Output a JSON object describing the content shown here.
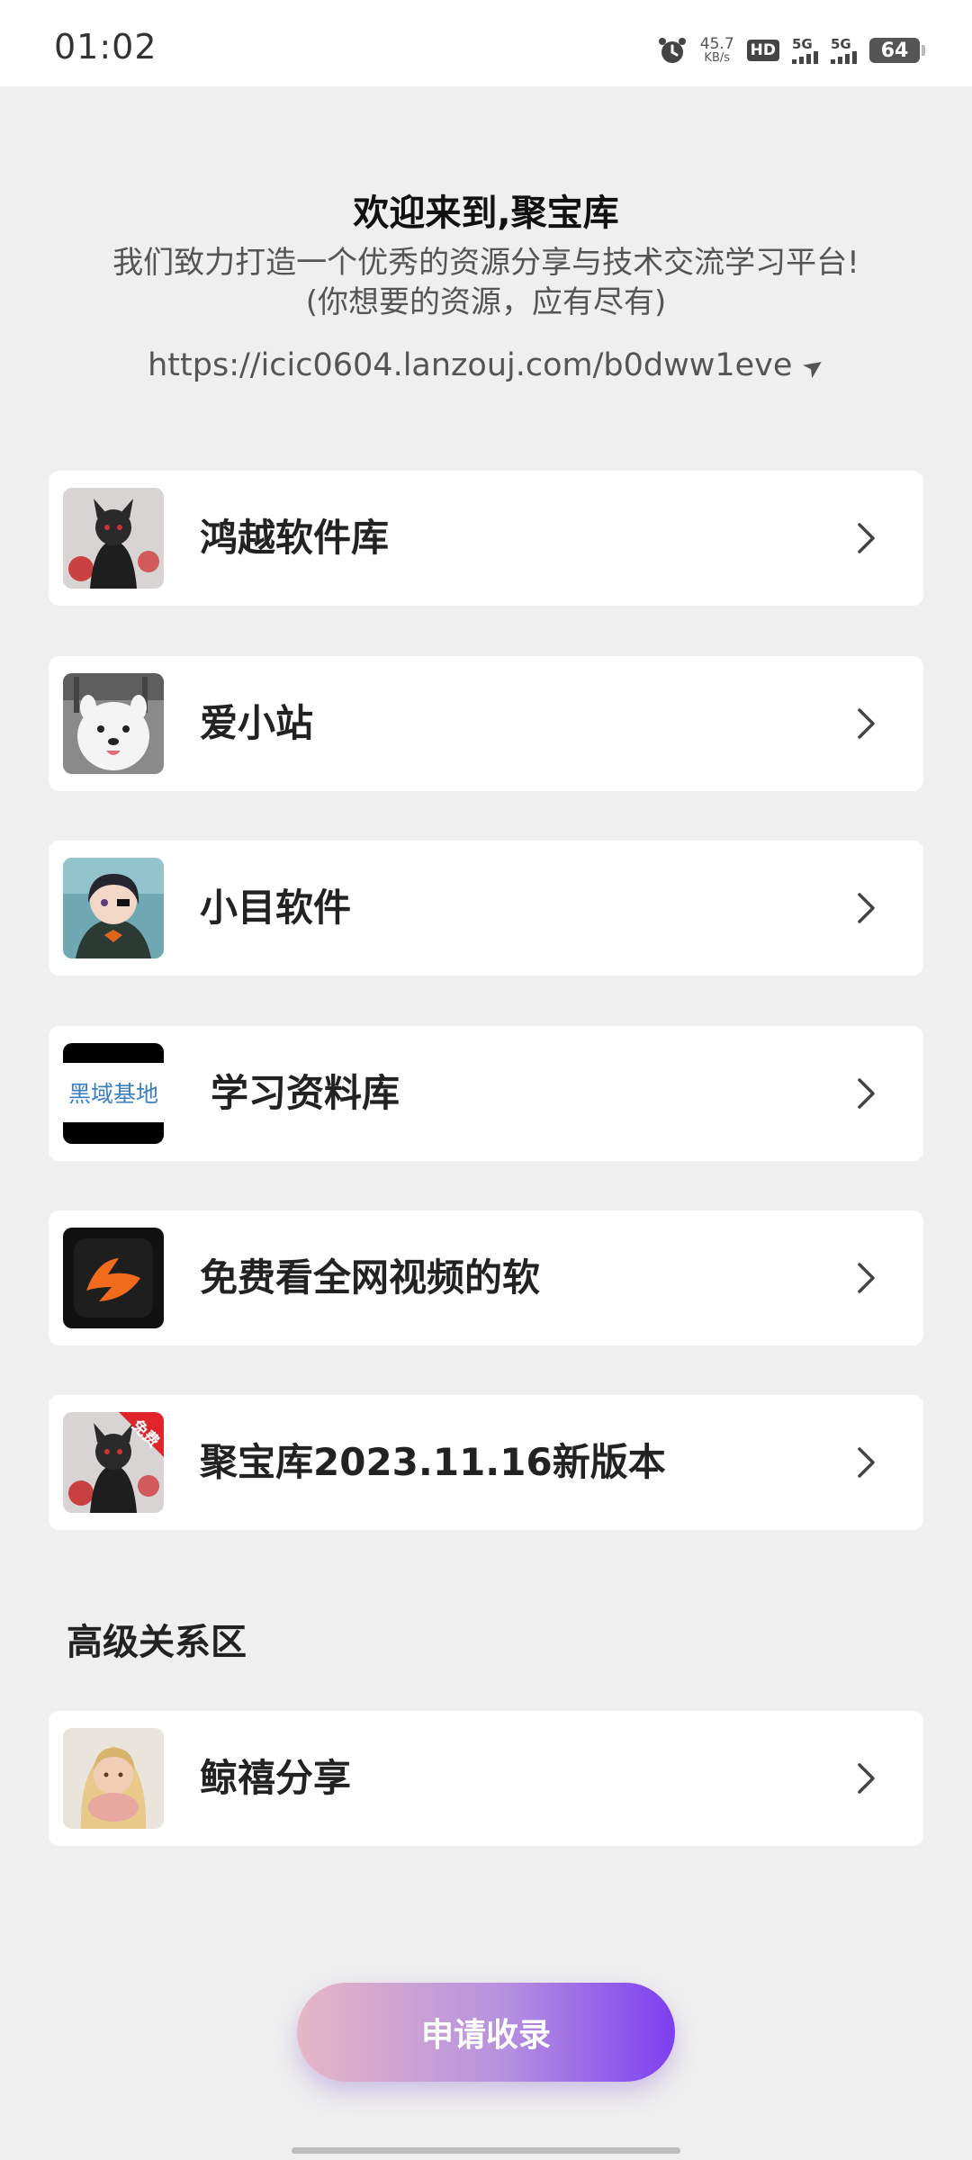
{
  "status_bar": {
    "time": "01:02",
    "net_speed": "45.7",
    "net_speed_unit": "KB/s",
    "hd_label": "HD",
    "sim1_label": "5G",
    "sim2_label": "5G",
    "battery": "64"
  },
  "header": {
    "title": "欢迎来到,聚宝库",
    "subtitle_line1": "我们致力打造一个优秀的资源分享与技术交流学习平台!",
    "subtitle_line2": "(你想要的资源，应有尽有)",
    "url": "https://icic0604.lanzouj.com/b0dww1eve"
  },
  "items": [
    {
      "label": "鸿越软件库",
      "icon": "avatar-black-cat"
    },
    {
      "label": "爱小站",
      "icon": "avatar-white-dog"
    },
    {
      "label": "小目软件",
      "icon": "avatar-anime-girl"
    },
    {
      "label": "学习资料库",
      "icon": "logo-heiyu-jidi",
      "logo_text": "黑域基地"
    },
    {
      "label": "免费看全网视频的软",
      "icon": "logo-orange-app"
    },
    {
      "label": "聚宝库2023.11.16新版本",
      "icon": "avatar-black-cat-free",
      "badge_text": "免费"
    }
  ],
  "section": {
    "title": "高级关系区",
    "items": [
      {
        "label": "鲸禧分享",
        "icon": "avatar-woman"
      }
    ]
  },
  "apply_button": {
    "label": "申请收录",
    "gradient_start": "#e6b7c5",
    "gradient_end": "#7d3ff0"
  }
}
